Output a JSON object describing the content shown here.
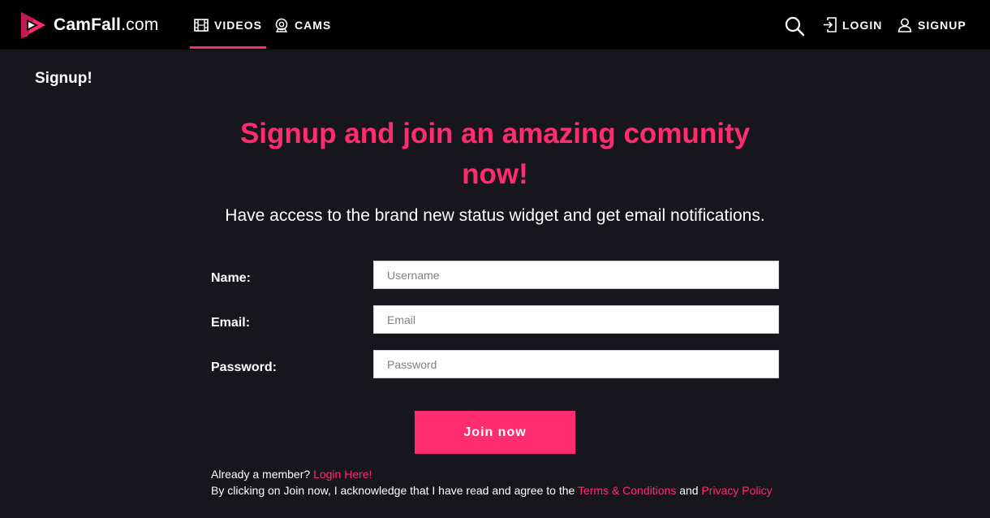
{
  "brand": {
    "name_bold": "CamFall",
    "name_suffix": ".com",
    "accent": "#ff2d6f"
  },
  "nav": {
    "videos": {
      "label": "VIDEOS",
      "icon": "film-icon",
      "active": true
    },
    "cams": {
      "label": "CAMS",
      "icon": "webcam-icon"
    },
    "search_icon": "search-icon",
    "login": {
      "label": "LOGIN",
      "icon": "login-icon"
    },
    "signup": {
      "label": "SIGNUP",
      "icon": "user-icon"
    }
  },
  "page": {
    "heading": "Signup!",
    "title": "Signup and join an amazing comunity now!",
    "subtitle": "Have access to the brand new status widget and get email notifications."
  },
  "form": {
    "name": {
      "label": "Name:",
      "placeholder": "Username",
      "value": ""
    },
    "email": {
      "label": "Email:",
      "placeholder": "Email",
      "value": ""
    },
    "password": {
      "label": "Password:",
      "placeholder": "Password",
      "value": ""
    },
    "submit_label": "Join now"
  },
  "footer": {
    "member_text": "Already a member?",
    "login_link": "Login Here!",
    "ack_text": "By clicking on Join now, I acknowledge that I have read and agree to the",
    "terms_link": "Terms & Conditions",
    "and_text": "and",
    "privacy_link": "Privacy Policy"
  }
}
